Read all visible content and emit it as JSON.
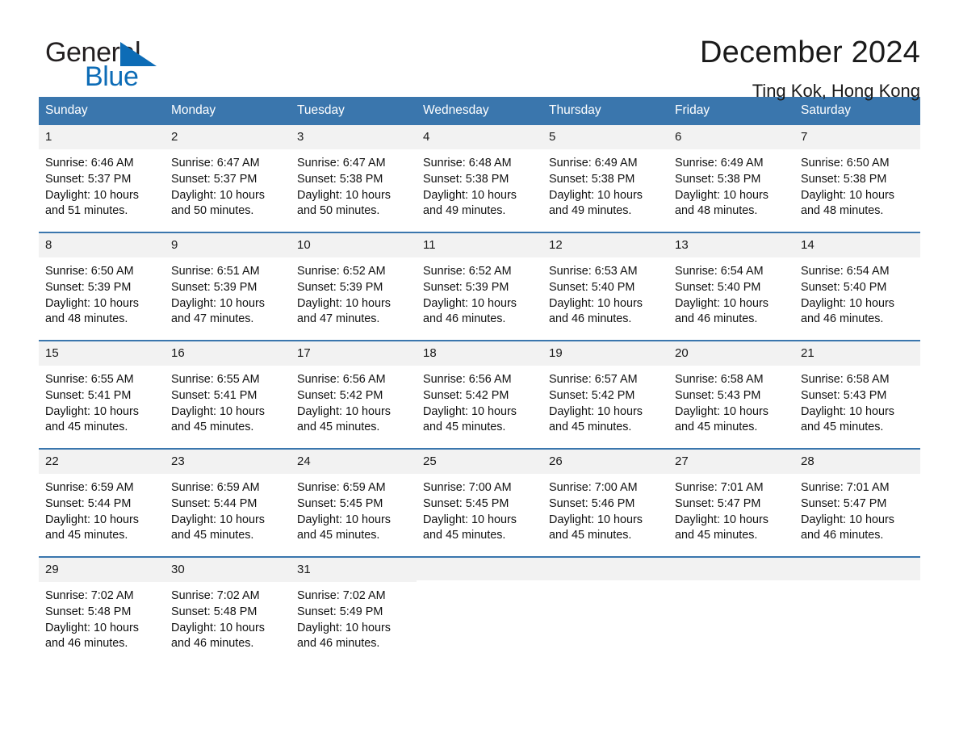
{
  "brand": {
    "word_one": "General",
    "word_two": "Blue",
    "mark_icon": "triangle-flag-icon"
  },
  "header": {
    "title": "December 2024",
    "subtitle": "Ting Kok, Hong Kong"
  },
  "colors": {
    "header_blue": "#3a76ad",
    "brand_blue": "#0d6cb6",
    "day_band": "#f2f2f2",
    "text": "#1a1a1a"
  },
  "calendar": {
    "weekdays": [
      "Sunday",
      "Monday",
      "Tuesday",
      "Wednesday",
      "Thursday",
      "Friday",
      "Saturday"
    ],
    "weeks": [
      [
        {
          "day": "1",
          "sunrise": "Sunrise: 6:46 AM",
          "sunset": "Sunset: 5:37 PM",
          "daylight_1": "Daylight: 10 hours",
          "daylight_2": "and 51 minutes."
        },
        {
          "day": "2",
          "sunrise": "Sunrise: 6:47 AM",
          "sunset": "Sunset: 5:37 PM",
          "daylight_1": "Daylight: 10 hours",
          "daylight_2": "and 50 minutes."
        },
        {
          "day": "3",
          "sunrise": "Sunrise: 6:47 AM",
          "sunset": "Sunset: 5:38 PM",
          "daylight_1": "Daylight: 10 hours",
          "daylight_2": "and 50 minutes."
        },
        {
          "day": "4",
          "sunrise": "Sunrise: 6:48 AM",
          "sunset": "Sunset: 5:38 PM",
          "daylight_1": "Daylight: 10 hours",
          "daylight_2": "and 49 minutes."
        },
        {
          "day": "5",
          "sunrise": "Sunrise: 6:49 AM",
          "sunset": "Sunset: 5:38 PM",
          "daylight_1": "Daylight: 10 hours",
          "daylight_2": "and 49 minutes."
        },
        {
          "day": "6",
          "sunrise": "Sunrise: 6:49 AM",
          "sunset": "Sunset: 5:38 PM",
          "daylight_1": "Daylight: 10 hours",
          "daylight_2": "and 48 minutes."
        },
        {
          "day": "7",
          "sunrise": "Sunrise: 6:50 AM",
          "sunset": "Sunset: 5:38 PM",
          "daylight_1": "Daylight: 10 hours",
          "daylight_2": "and 48 minutes."
        }
      ],
      [
        {
          "day": "8",
          "sunrise": "Sunrise: 6:50 AM",
          "sunset": "Sunset: 5:39 PM",
          "daylight_1": "Daylight: 10 hours",
          "daylight_2": "and 48 minutes."
        },
        {
          "day": "9",
          "sunrise": "Sunrise: 6:51 AM",
          "sunset": "Sunset: 5:39 PM",
          "daylight_1": "Daylight: 10 hours",
          "daylight_2": "and 47 minutes."
        },
        {
          "day": "10",
          "sunrise": "Sunrise: 6:52 AM",
          "sunset": "Sunset: 5:39 PM",
          "daylight_1": "Daylight: 10 hours",
          "daylight_2": "and 47 minutes."
        },
        {
          "day": "11",
          "sunrise": "Sunrise: 6:52 AM",
          "sunset": "Sunset: 5:39 PM",
          "daylight_1": "Daylight: 10 hours",
          "daylight_2": "and 46 minutes."
        },
        {
          "day": "12",
          "sunrise": "Sunrise: 6:53 AM",
          "sunset": "Sunset: 5:40 PM",
          "daylight_1": "Daylight: 10 hours",
          "daylight_2": "and 46 minutes."
        },
        {
          "day": "13",
          "sunrise": "Sunrise: 6:54 AM",
          "sunset": "Sunset: 5:40 PM",
          "daylight_1": "Daylight: 10 hours",
          "daylight_2": "and 46 minutes."
        },
        {
          "day": "14",
          "sunrise": "Sunrise: 6:54 AM",
          "sunset": "Sunset: 5:40 PM",
          "daylight_1": "Daylight: 10 hours",
          "daylight_2": "and 46 minutes."
        }
      ],
      [
        {
          "day": "15",
          "sunrise": "Sunrise: 6:55 AM",
          "sunset": "Sunset: 5:41 PM",
          "daylight_1": "Daylight: 10 hours",
          "daylight_2": "and 45 minutes."
        },
        {
          "day": "16",
          "sunrise": "Sunrise: 6:55 AM",
          "sunset": "Sunset: 5:41 PM",
          "daylight_1": "Daylight: 10 hours",
          "daylight_2": "and 45 minutes."
        },
        {
          "day": "17",
          "sunrise": "Sunrise: 6:56 AM",
          "sunset": "Sunset: 5:42 PM",
          "daylight_1": "Daylight: 10 hours",
          "daylight_2": "and 45 minutes."
        },
        {
          "day": "18",
          "sunrise": "Sunrise: 6:56 AM",
          "sunset": "Sunset: 5:42 PM",
          "daylight_1": "Daylight: 10 hours",
          "daylight_2": "and 45 minutes."
        },
        {
          "day": "19",
          "sunrise": "Sunrise: 6:57 AM",
          "sunset": "Sunset: 5:42 PM",
          "daylight_1": "Daylight: 10 hours",
          "daylight_2": "and 45 minutes."
        },
        {
          "day": "20",
          "sunrise": "Sunrise: 6:58 AM",
          "sunset": "Sunset: 5:43 PM",
          "daylight_1": "Daylight: 10 hours",
          "daylight_2": "and 45 minutes."
        },
        {
          "day": "21",
          "sunrise": "Sunrise: 6:58 AM",
          "sunset": "Sunset: 5:43 PM",
          "daylight_1": "Daylight: 10 hours",
          "daylight_2": "and 45 minutes."
        }
      ],
      [
        {
          "day": "22",
          "sunrise": "Sunrise: 6:59 AM",
          "sunset": "Sunset: 5:44 PM",
          "daylight_1": "Daylight: 10 hours",
          "daylight_2": "and 45 minutes."
        },
        {
          "day": "23",
          "sunrise": "Sunrise: 6:59 AM",
          "sunset": "Sunset: 5:44 PM",
          "daylight_1": "Daylight: 10 hours",
          "daylight_2": "and 45 minutes."
        },
        {
          "day": "24",
          "sunrise": "Sunrise: 6:59 AM",
          "sunset": "Sunset: 5:45 PM",
          "daylight_1": "Daylight: 10 hours",
          "daylight_2": "and 45 minutes."
        },
        {
          "day": "25",
          "sunrise": "Sunrise: 7:00 AM",
          "sunset": "Sunset: 5:45 PM",
          "daylight_1": "Daylight: 10 hours",
          "daylight_2": "and 45 minutes."
        },
        {
          "day": "26",
          "sunrise": "Sunrise: 7:00 AM",
          "sunset": "Sunset: 5:46 PM",
          "daylight_1": "Daylight: 10 hours",
          "daylight_2": "and 45 minutes."
        },
        {
          "day": "27",
          "sunrise": "Sunrise: 7:01 AM",
          "sunset": "Sunset: 5:47 PM",
          "daylight_1": "Daylight: 10 hours",
          "daylight_2": "and 45 minutes."
        },
        {
          "day": "28",
          "sunrise": "Sunrise: 7:01 AM",
          "sunset": "Sunset: 5:47 PM",
          "daylight_1": "Daylight: 10 hours",
          "daylight_2": "and 46 minutes."
        }
      ],
      [
        {
          "day": "29",
          "sunrise": "Sunrise: 7:02 AM",
          "sunset": "Sunset: 5:48 PM",
          "daylight_1": "Daylight: 10 hours",
          "daylight_2": "and 46 minutes."
        },
        {
          "day": "30",
          "sunrise": "Sunrise: 7:02 AM",
          "sunset": "Sunset: 5:48 PM",
          "daylight_1": "Daylight: 10 hours",
          "daylight_2": "and 46 minutes."
        },
        {
          "day": "31",
          "sunrise": "Sunrise: 7:02 AM",
          "sunset": "Sunset: 5:49 PM",
          "daylight_1": "Daylight: 10 hours",
          "daylight_2": "and 46 minutes."
        },
        {
          "day": "",
          "sunrise": "",
          "sunset": "",
          "daylight_1": "",
          "daylight_2": ""
        },
        {
          "day": "",
          "sunrise": "",
          "sunset": "",
          "daylight_1": "",
          "daylight_2": ""
        },
        {
          "day": "",
          "sunrise": "",
          "sunset": "",
          "daylight_1": "",
          "daylight_2": ""
        },
        {
          "day": "",
          "sunrise": "",
          "sunset": "",
          "daylight_1": "",
          "daylight_2": ""
        }
      ]
    ]
  }
}
